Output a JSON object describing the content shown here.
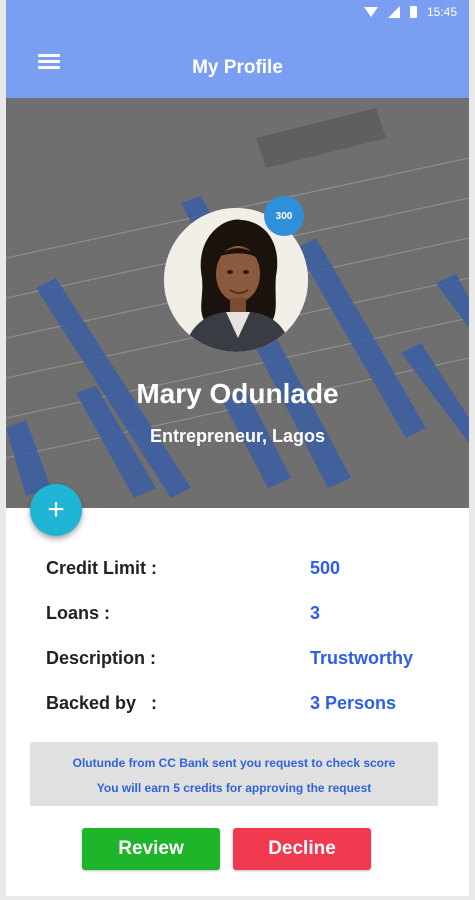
{
  "status_bar": {
    "time": "15:45",
    "icons": [
      "wifi-icon",
      "signal-icon",
      "battery-icon"
    ]
  },
  "app_bar": {
    "title": "My Profile",
    "menu_icon": "menu-icon"
  },
  "profile": {
    "name": "Mary Odunlade",
    "subtitle": "Entrepreneur, Lagos",
    "score_badge": "300"
  },
  "fab": {
    "label": "+"
  },
  "details": [
    {
      "label": "Credit Limit :",
      "value": "500"
    },
    {
      "label": "Loans :",
      "value": "3"
    },
    {
      "label": "Description :",
      "value": "Trustworthy"
    },
    {
      "label": "Backed by   :",
      "value": "3 Persons"
    }
  ],
  "notice": {
    "line1": "Olutunde from CC Bank sent you request to check score",
    "line2": "You will earn 5 credits for approving the request"
  },
  "actions": {
    "review_label": "Review",
    "decline_label": "Decline"
  },
  "colors": {
    "app_bar": "#7a9ff2",
    "badge": "#2f8fd8",
    "fab": "#1fb6d6",
    "value_text": "#2f5ee8",
    "review": "#1fb52a",
    "decline": "#f0394f"
  }
}
